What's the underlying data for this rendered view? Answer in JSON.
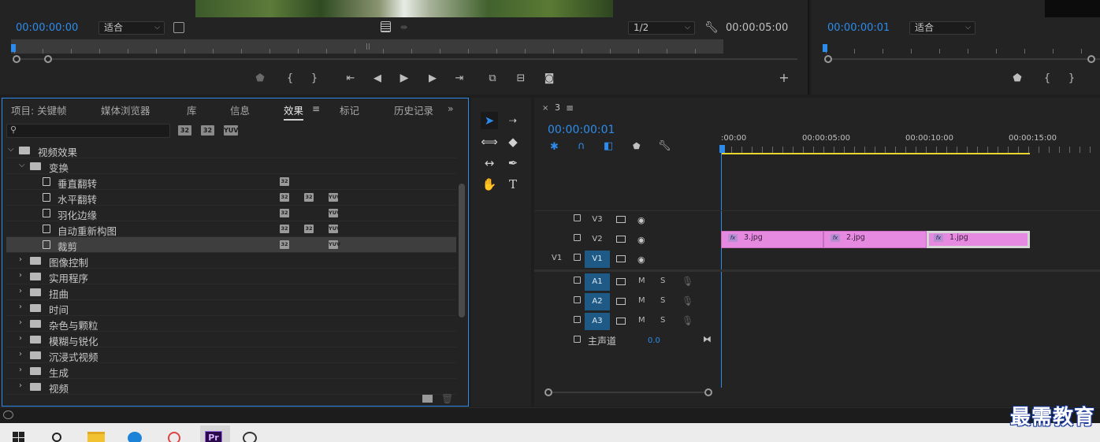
{
  "source_monitor": {
    "timecode_in": "00:00:00:00",
    "fit_label": "适合",
    "resolution": "1/2",
    "duration": "00:00:05:00"
  },
  "program_monitor": {
    "timecode": "00:00:00:01",
    "fit_label": "适合"
  },
  "effects_panel": {
    "tabs": [
      "项目: 关键帧",
      "媒体浏览器",
      "库",
      "信息",
      "效果",
      "标记",
      "历史记录"
    ],
    "active_tab": "效果",
    "overflow": "»",
    "search_placeholder": "",
    "filter_badges": [
      "32",
      "32",
      "YUV"
    ],
    "tree": [
      {
        "label": "视频效果",
        "level": 0,
        "expanded": true,
        "type": "folder"
      },
      {
        "label": "变换",
        "level": 1,
        "expanded": true,
        "type": "folder"
      },
      {
        "label": "垂直翻转",
        "level": 2,
        "type": "effect",
        "badges": [
          "32"
        ]
      },
      {
        "label": "水平翻转",
        "level": 2,
        "type": "effect",
        "badges": [
          "32",
          "32",
          "YUV"
        ]
      },
      {
        "label": "羽化边缘",
        "level": 2,
        "type": "effect",
        "badges": [
          "32",
          "",
          "YUV"
        ]
      },
      {
        "label": "自动重新构图",
        "level": 2,
        "type": "effect",
        "badges": [
          "32",
          "32",
          "YUV"
        ]
      },
      {
        "label": "裁剪",
        "level": 2,
        "type": "effect",
        "badges": [
          "32",
          "",
          "YUV"
        ],
        "selected": true
      },
      {
        "label": "图像控制",
        "level": 1,
        "expanded": false,
        "type": "folder"
      },
      {
        "label": "实用程序",
        "level": 1,
        "expanded": false,
        "type": "folder"
      },
      {
        "label": "扭曲",
        "level": 1,
        "expanded": false,
        "type": "folder"
      },
      {
        "label": "时间",
        "level": 1,
        "expanded": false,
        "type": "folder"
      },
      {
        "label": "杂色与颗粒",
        "level": 1,
        "expanded": false,
        "type": "folder"
      },
      {
        "label": "模糊与锐化",
        "level": 1,
        "expanded": false,
        "type": "folder"
      },
      {
        "label": "沉浸式视频",
        "level": 1,
        "expanded": false,
        "type": "folder"
      },
      {
        "label": "生成",
        "level": 1,
        "expanded": false,
        "type": "folder"
      },
      {
        "label": "视频",
        "level": 1,
        "expanded": false,
        "type": "folder"
      }
    ]
  },
  "timeline": {
    "sequence_name": "3",
    "timecode": "00:00:00:01",
    "ruler_labels": [
      ":00:00",
      "00:00:05:00",
      "00:00:10:00",
      "00:00:15:00"
    ],
    "video_tracks": [
      {
        "name": "V3",
        "source": ""
      },
      {
        "name": "V2",
        "source": ""
      },
      {
        "name": "V1",
        "source": "V1"
      }
    ],
    "audio_tracks": [
      {
        "name": "A1",
        "m": "M",
        "s": "S"
      },
      {
        "name": "A2",
        "m": "M",
        "s": "S"
      },
      {
        "name": "A3",
        "m": "M",
        "s": "S"
      }
    ],
    "master": {
      "label": "主声道",
      "value": "0.0"
    },
    "clips": [
      {
        "name": "3.jpg",
        "fx": "fx"
      },
      {
        "name": "2.jpg",
        "fx": "fx"
      },
      {
        "name": "1.jpg",
        "fx": "fx"
      }
    ]
  },
  "watermark": "最需教育",
  "colors": {
    "accent": "#2d8ceb",
    "clip": "#e58ae0",
    "track_on": "#1f5a86",
    "panel": "#232323"
  }
}
